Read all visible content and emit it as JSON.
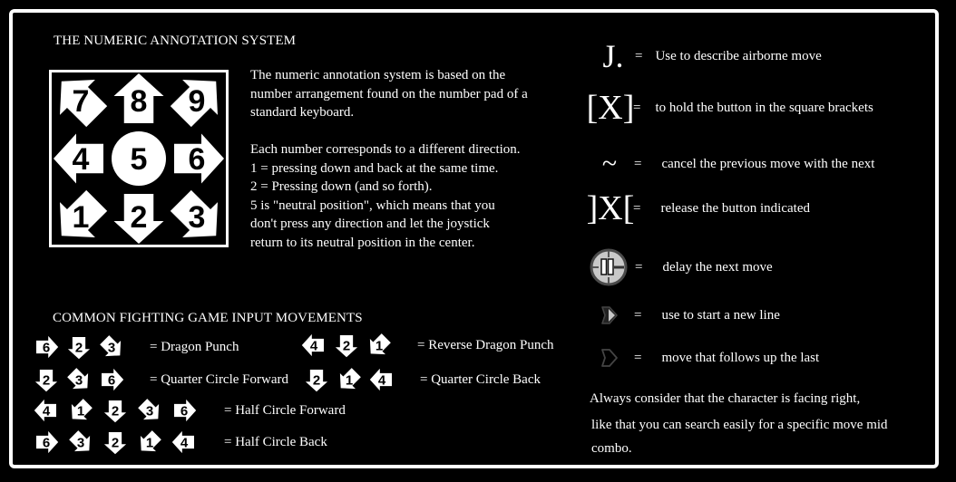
{
  "numeric_section": {
    "title": "THE NUMERIC ANNOTATION SYSTEM",
    "numpad": [
      {
        "number": "7",
        "direction": "up-back"
      },
      {
        "number": "8",
        "direction": "up"
      },
      {
        "number": "9",
        "direction": "up-forward"
      },
      {
        "number": "4",
        "direction": "back"
      },
      {
        "number": "5",
        "direction": "neutral"
      },
      {
        "number": "6",
        "direction": "forward"
      },
      {
        "number": "1",
        "direction": "down-back"
      },
      {
        "number": "2",
        "direction": "down"
      },
      {
        "number": "3",
        "direction": "down-forward"
      }
    ],
    "paragraph1": "The numeric annotation system is based on the number arrangement found on the number pad of a standard keyboard.",
    "paragraph2_lines": [
      "Each number corresponds to a different direction.",
      "1 = pressing down and back at the same time.",
      "2 = Pressing down (and so forth).",
      "5 is \"neutral position\", which means that you don't press any direction and let the joystick return to its neutral position in the center."
    ]
  },
  "movements_section": {
    "title": "COMMON FIGHTING GAME INPUT MOVEMENTS",
    "moves": [
      {
        "inputs": [
          "6",
          "2",
          "3"
        ],
        "label": "= Dragon Punch"
      },
      {
        "inputs": [
          "4",
          "2",
          "1"
        ],
        "label": "= Reverse Dragon Punch"
      },
      {
        "inputs": [
          "2",
          "3",
          "6"
        ],
        "label": "= Quarter Circle Forward"
      },
      {
        "inputs": [
          "2",
          "1",
          "4"
        ],
        "label": "= Quarter Circle Back"
      },
      {
        "inputs": [
          "4",
          "1",
          "2",
          "3",
          "6"
        ],
        "label": "= Half Circle Forward"
      },
      {
        "inputs": [
          "6",
          "3",
          "2",
          "1",
          "4"
        ],
        "label": "= Half Circle Back"
      }
    ]
  },
  "legend": {
    "equals": "=",
    "items": [
      {
        "symbol": "J.",
        "icon": "jump-notation",
        "text": "Use to describe airborne move"
      },
      {
        "symbol": "[X]",
        "icon": "hold-brackets",
        "text": "to hold the button in the square brackets"
      },
      {
        "symbol": "~",
        "icon": "tilde",
        "text": "cancel the previous move with the next"
      },
      {
        "symbol": "]X[",
        "icon": "release-brackets",
        "text": "release the button indicated"
      },
      {
        "symbol": "",
        "icon": "delay-clock-icon",
        "text": "delay the next move"
      },
      {
        "symbol": "",
        "icon": "new-line-arrow-icon",
        "text": "use to start a new line"
      },
      {
        "symbol": "",
        "icon": "follow-up-arrow-icon",
        "text": "move that follows up the last"
      }
    ]
  },
  "note": {
    "lines": [
      "Always consider that the character is facing right,",
      "like that you can search easily for a specific move mid combo."
    ]
  },
  "colors": {
    "background": "#000000",
    "foreground": "#ffffff",
    "icon_gray": "#c8c8c8",
    "icon_dark": "#3a3a3a"
  }
}
